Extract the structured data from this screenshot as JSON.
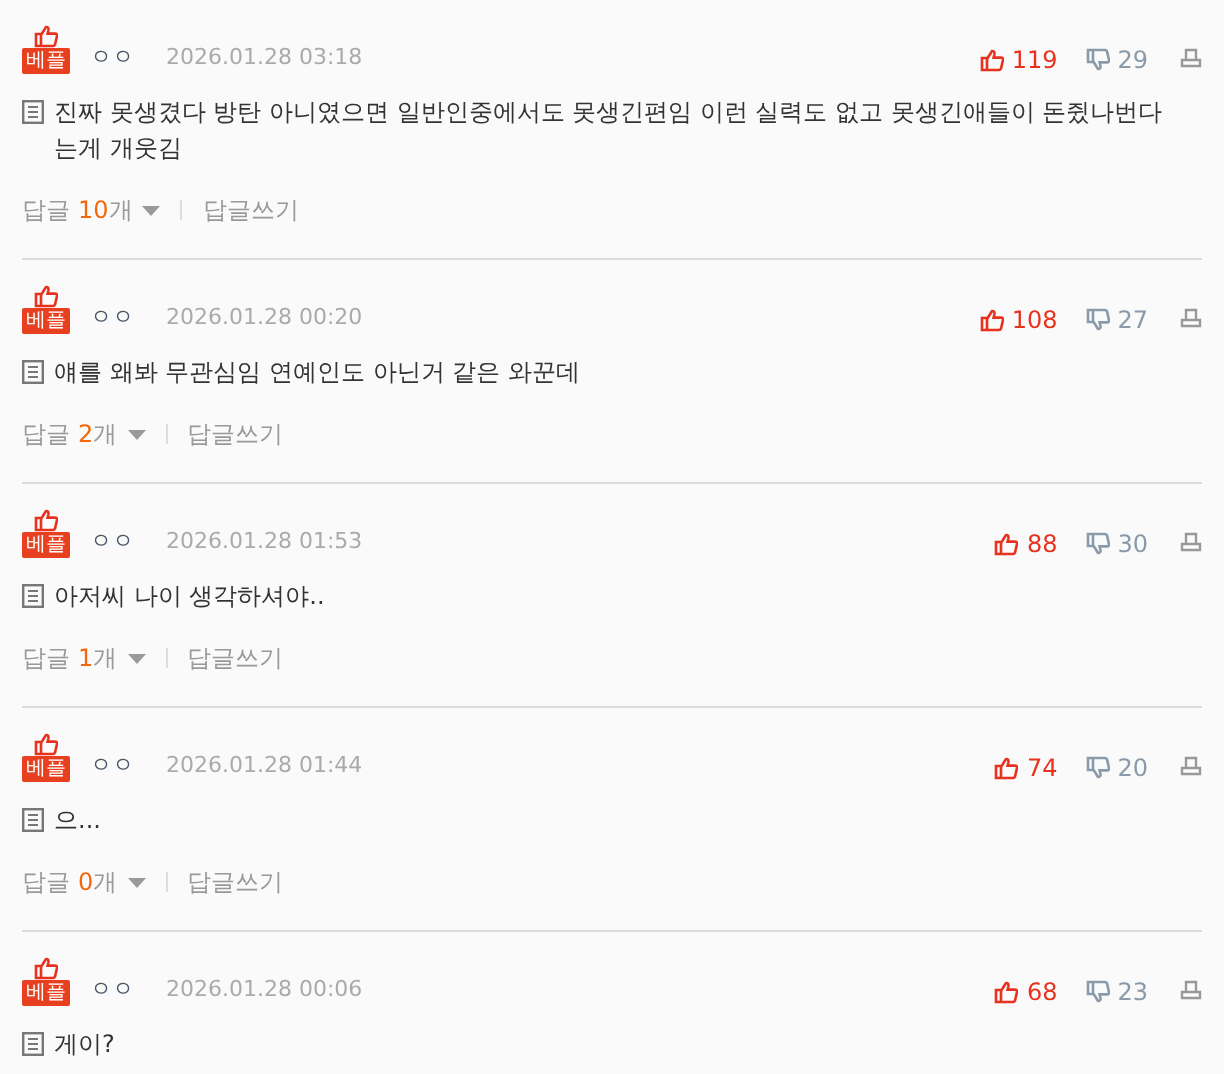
{
  "comments": [
    {
      "badge": "베플",
      "author": "ㅇㅇ",
      "date": "2026.01.28 03:18",
      "likes": "119",
      "dislikes": "29",
      "text": "진짜 못생겼다 방탄 아니였으면 일반인중에서도 못생긴편임 이런 실력도 없고 못생긴애들이 돈쥤나번다는게 개웃김",
      "reply_prefix": "답글",
      "reply_count": "10",
      "reply_suffix": "개",
      "reply_write": "답글쓰기"
    },
    {
      "badge": "베플",
      "author": "ㅇㅇ",
      "date": "2026.01.28 00:20",
      "likes": "108",
      "dislikes": "27",
      "text": "얘를 왜봐 무관심임 연예인도 아닌거 같은 와꾼데",
      "reply_prefix": "답글",
      "reply_count": "2",
      "reply_suffix": "개",
      "reply_write": "답글쓰기"
    },
    {
      "badge": "베플",
      "author": "ㅇㅇ",
      "date": "2026.01.28 01:53",
      "likes": "88",
      "dislikes": "30",
      "text": "아저씨 나이 생각하셔야..",
      "reply_prefix": "답글",
      "reply_count": "1",
      "reply_suffix": "개",
      "reply_write": "답글쓰기"
    },
    {
      "badge": "베플",
      "author": "ㅇㅇ",
      "date": "2026.01.28 01:44",
      "likes": "74",
      "dislikes": "20",
      "text": "으...",
      "reply_prefix": "답글",
      "reply_count": "0",
      "reply_suffix": "개",
      "reply_write": "답글쓰기"
    },
    {
      "badge": "베플",
      "author": "ㅇㅇ",
      "date": "2026.01.28 00:06",
      "likes": "68",
      "dislikes": "23",
      "text": "게이?"
    }
  ]
}
